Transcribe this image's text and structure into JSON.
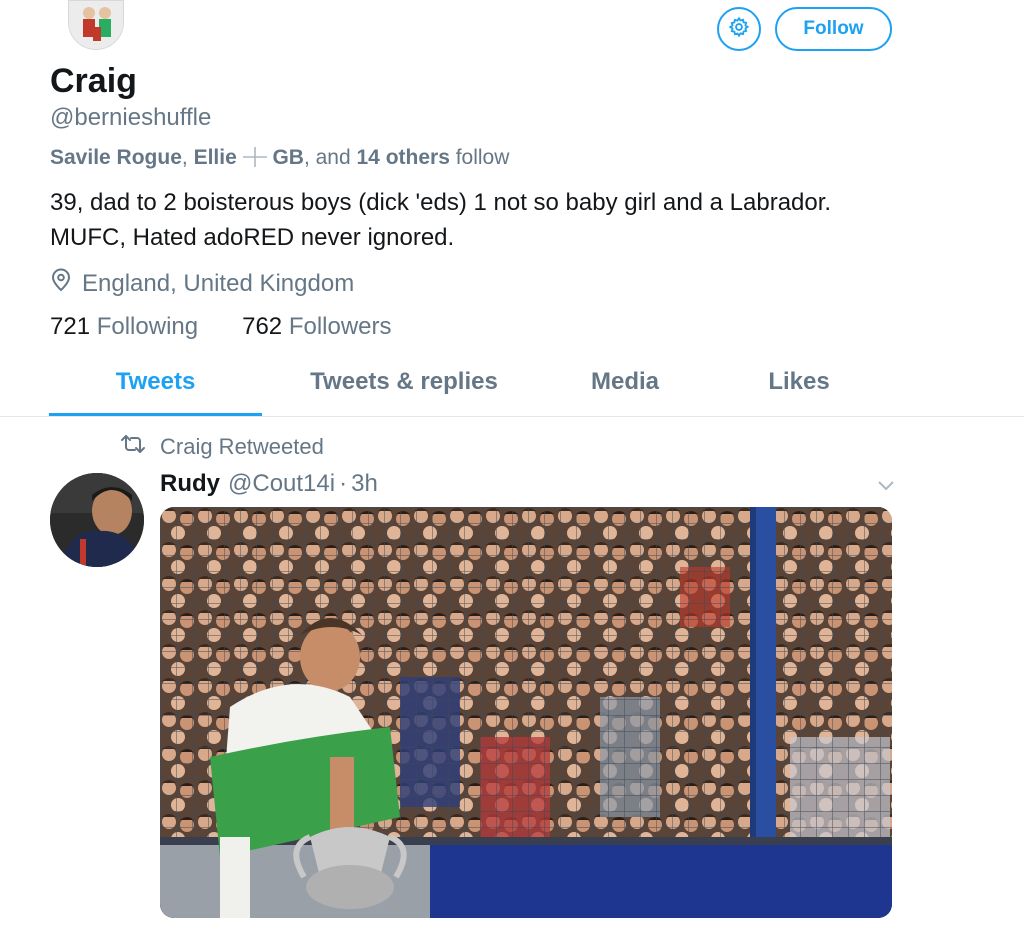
{
  "profile": {
    "display_name": "Craig",
    "handle": "@bernieshuffle",
    "followed_by": {
      "name1": "Savile Rogue",
      "sep1": ", ",
      "name2": "Ellie",
      "name3": "GB",
      "and_text": ", and ",
      "others": "14 others",
      "follow_word": " follow"
    },
    "bio": "39, dad to 2 boisterous boys (dick 'eds) 1 not so baby girl and a Labrador. MUFC, Hated adoRED never ignored.",
    "location": "England, United Kingdom",
    "following_count": "721",
    "following_label": "Following",
    "followers_count": "762",
    "followers_label": "Followers"
  },
  "actions": {
    "follow_label": "Follow",
    "settings_icon": "gear-icon"
  },
  "tabs": [
    {
      "label": "Tweets",
      "active": true
    },
    {
      "label": "Tweets & replies",
      "active": false
    },
    {
      "label": "Media",
      "active": false
    },
    {
      "label": "Likes",
      "active": false
    }
  ],
  "tweet": {
    "retweet_label": "Craig Retweeted",
    "author_name": "Rudy",
    "author_handle": "@Cout14i",
    "separator": "·",
    "time": "3h"
  },
  "colors": {
    "accent": "#1da1f2",
    "secondary_text": "#657786",
    "primary_text": "#14171a",
    "divider": "#e1e8ed"
  }
}
